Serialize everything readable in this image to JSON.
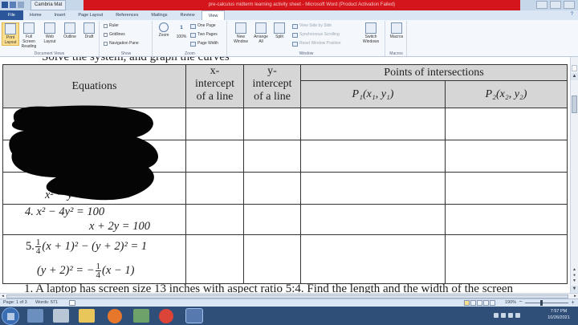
{
  "window": {
    "doc_tab": "Cambria Mat",
    "title": "pre-calculus midterm learning activity sheet - Microsoft Word (Product Activation Failed)"
  },
  "ribbon": {
    "tabs": [
      "File",
      "Home",
      "Insert",
      "Page Layout",
      "References",
      "Mailings",
      "Review",
      "View"
    ],
    "active_tab": "View",
    "document_views": {
      "label": "Document Views",
      "buttons": [
        "Print Layout",
        "Full Screen Reading",
        "Web Layout",
        "Outline",
        "Draft"
      ]
    },
    "show": {
      "label": "Show",
      "items": [
        "Ruler",
        "Gridlines",
        "Navigation Pane"
      ]
    },
    "zoom": {
      "label": "Zoom",
      "buttons": [
        "Zoom",
        "100%"
      ],
      "small": [
        "One Page",
        "Two Pages",
        "Page Width"
      ]
    },
    "window_group": {
      "label": "Window",
      "buttons": [
        "New Window",
        "Arrange All",
        "Split"
      ],
      "small": [
        "View Side by Side",
        "Synchronous Scrolling",
        "Reset Window Position"
      ],
      "switch": "Switch Windows"
    },
    "macros": {
      "label": "Macros",
      "button": "Macros"
    }
  },
  "document": {
    "cut_heading": "Solve the system, and graph the curves",
    "table": {
      "headers": {
        "equations": "Equations",
        "x_intercept": [
          "x-",
          "intercept",
          "of a line"
        ],
        "y_intercept": [
          "y-",
          "intercept",
          "of a line"
        ],
        "points": "Points of intersections",
        "p1": "P₁(x₁, y₁)",
        "p2": "P₂(x₂, y₂)"
      },
      "rows": [
        {
          "lines": [
            ""
          ]
        },
        {
          "lines": [
            ""
          ]
        },
        {
          "lines": [
            "x² − y"
          ]
        },
        {
          "lines": [
            "4.  x² − 4y² = 100",
            "x + 2y = 100"
          ]
        },
        {
          "lines": [
            "5.",
            "(x + 1)² − (y + 2)² = 1",
            "(y + 2)² = −",
            "(x − 1)"
          ],
          "frac1": {
            "num": "1",
            "den": "4"
          },
          "frac2": {
            "num": "1",
            "den": "4"
          }
        }
      ]
    },
    "next_line": "1.   A laptop has screen size 13 inches with aspect ratio 5:4. Find the length and the width of the screen"
  },
  "status": {
    "page": "Page: 1 of 3",
    "words": "Words: 571",
    "zoom": "190%"
  },
  "taskbar": {
    "time": "7:57 PM",
    "date": "10/26/2021"
  },
  "colors": {
    "accent": "#2b579a",
    "title_red": "#d4151b",
    "header_gray": "#d6d6d6",
    "taskbar": "#2f4f79"
  }
}
